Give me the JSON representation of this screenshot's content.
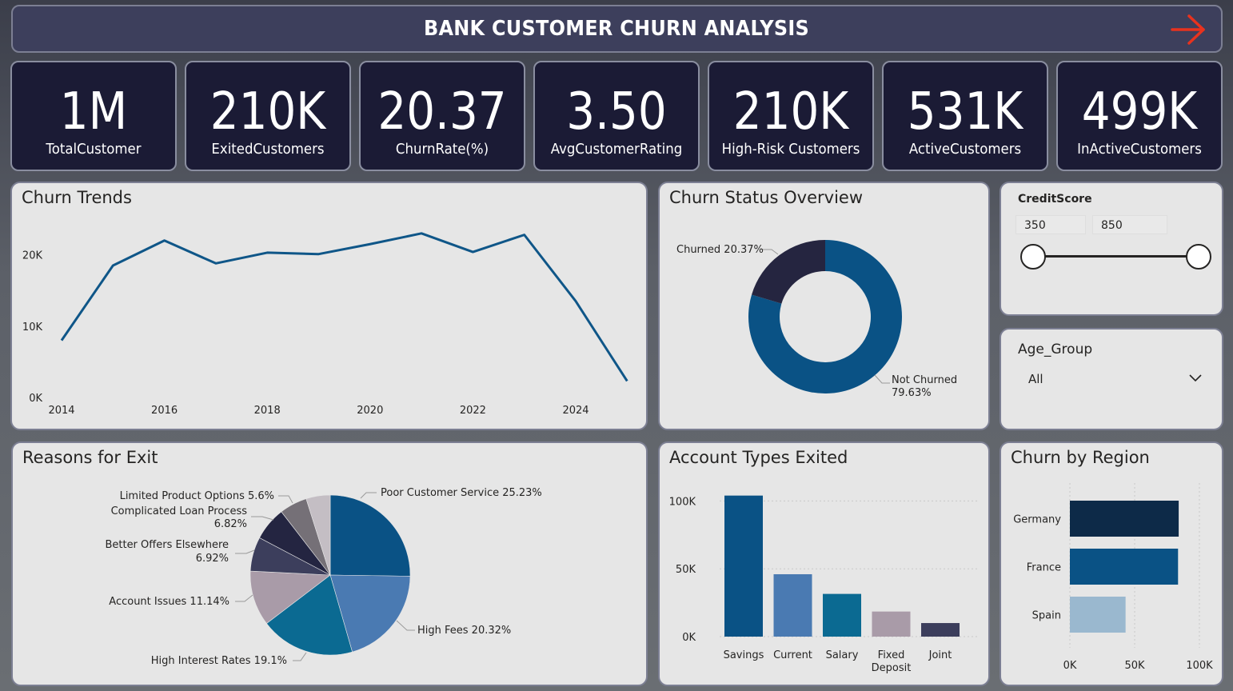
{
  "header": {
    "title": "BANK CUSTOMER CHURN ANALYSIS",
    "arrow_icon": "arrow-right-icon",
    "arrow_color": "#e8321e"
  },
  "kpis": [
    {
      "value": "1M",
      "label": "TotalCustomer"
    },
    {
      "value": "210K",
      "label": "ExitedCustomers"
    },
    {
      "value": "20.37",
      "label": "ChurnRate(%)"
    },
    {
      "value": "3.50",
      "label": "AvgCustomerRating"
    },
    {
      "value": "210K",
      "label": "High-Risk Customers"
    },
    {
      "value": "531K",
      "label": "ActiveCustomers"
    },
    {
      "value": "499K",
      "label": "InActiveCustomers"
    }
  ],
  "churn_trends": {
    "title": "Churn Trends",
    "chart_data": {
      "type": "line",
      "x": [
        2014,
        2015,
        2016,
        2017,
        2018,
        2019,
        2020,
        2021,
        2022,
        2023,
        2024,
        2025
      ],
      "series": [
        {
          "values": [
            8000,
            18500,
            22000,
            18800,
            20300,
            20100,
            21500,
            23000,
            20400,
            22800,
            13500,
            2300
          ]
        }
      ],
      "x_tick_labels": [
        "2014",
        "2016",
        "2018",
        "2020",
        "2022",
        "2024"
      ],
      "y_tick_labels": [
        "0K",
        "10K",
        "20K"
      ],
      "ylim": [
        0,
        25000
      ],
      "color": "#0f5688"
    }
  },
  "churn_status": {
    "title": "Churn Status Overview",
    "chart_data": {
      "type": "pie",
      "donut": true,
      "slices": [
        {
          "label": "Not Churned",
          "value": 79.63,
          "pct_text": "79.63%",
          "color": "#0a5285"
        },
        {
          "label": "Churned",
          "value": 20.37,
          "pct_text": "20.37%",
          "color": "#252540"
        }
      ]
    }
  },
  "credit_score": {
    "title": "CreditScore",
    "min": "350",
    "max": "850"
  },
  "age_group": {
    "title": "Age_Group",
    "selected": "All"
  },
  "reasons": {
    "title": "Reasons for Exit",
    "chart_data": {
      "type": "pie",
      "slices": [
        {
          "label": "Poor Customer Service",
          "value": 25.23,
          "pct_text": "25.23%",
          "color": "#0a5285"
        },
        {
          "label": "High Fees",
          "value": 20.32,
          "pct_text": "20.32%",
          "color": "#4a7ab2"
        },
        {
          "label": "High Interest Rates",
          "value": 19.1,
          "pct_text": "19.1%",
          "color": "#0b6a92"
        },
        {
          "label": "Account Issues",
          "value": 11.14,
          "pct_text": "11.14%",
          "color": "#a99ba8"
        },
        {
          "label": "Better Offers Elsewhere",
          "value": 6.92,
          "pct_text": "6.92%",
          "color": "#3c3e5c"
        },
        {
          "label": "Complicated Loan Process",
          "value": 6.82,
          "pct_text": "6.82%",
          "color": "#242541"
        },
        {
          "label": "Limited Product Options",
          "value": 5.6,
          "pct_text": "5.6%",
          "color": "#757077"
        },
        {
          "label": "",
          "value": 4.87,
          "pct_text": "",
          "color": "#c4bec4"
        }
      ]
    }
  },
  "account_types": {
    "title": "Account Types Exited",
    "chart_data": {
      "type": "bar",
      "categories": [
        "Savings",
        "Current",
        "Salary",
        "Fixed Deposit",
        "Joint"
      ],
      "category_lines": [
        [
          "Savings"
        ],
        [
          "Current"
        ],
        [
          "Salary"
        ],
        [
          "Fixed",
          "Deposit"
        ],
        [
          "Joint"
        ]
      ],
      "values": [
        104000,
        46000,
        31500,
        18500,
        10000
      ],
      "colors": [
        "#0a5285",
        "#4a7ab2",
        "#0b6a92",
        "#a99ba8",
        "#3c3e5c"
      ],
      "y_tick_labels": [
        "0K",
        "50K",
        "100K"
      ],
      "ylim": [
        0,
        115000
      ]
    }
  },
  "region": {
    "title": "Churn by Region",
    "chart_data": {
      "type": "bar",
      "orientation": "horizontal",
      "categories": [
        "Germany",
        "France",
        "Spain"
      ],
      "values": [
        84000,
        83500,
        43000
      ],
      "colors": [
        "#0d2a48",
        "#0a5285",
        "#9ab8cf"
      ],
      "x_tick_labels": [
        "0K",
        "50K",
        "100K"
      ],
      "xlim": [
        0,
        100000
      ]
    }
  }
}
